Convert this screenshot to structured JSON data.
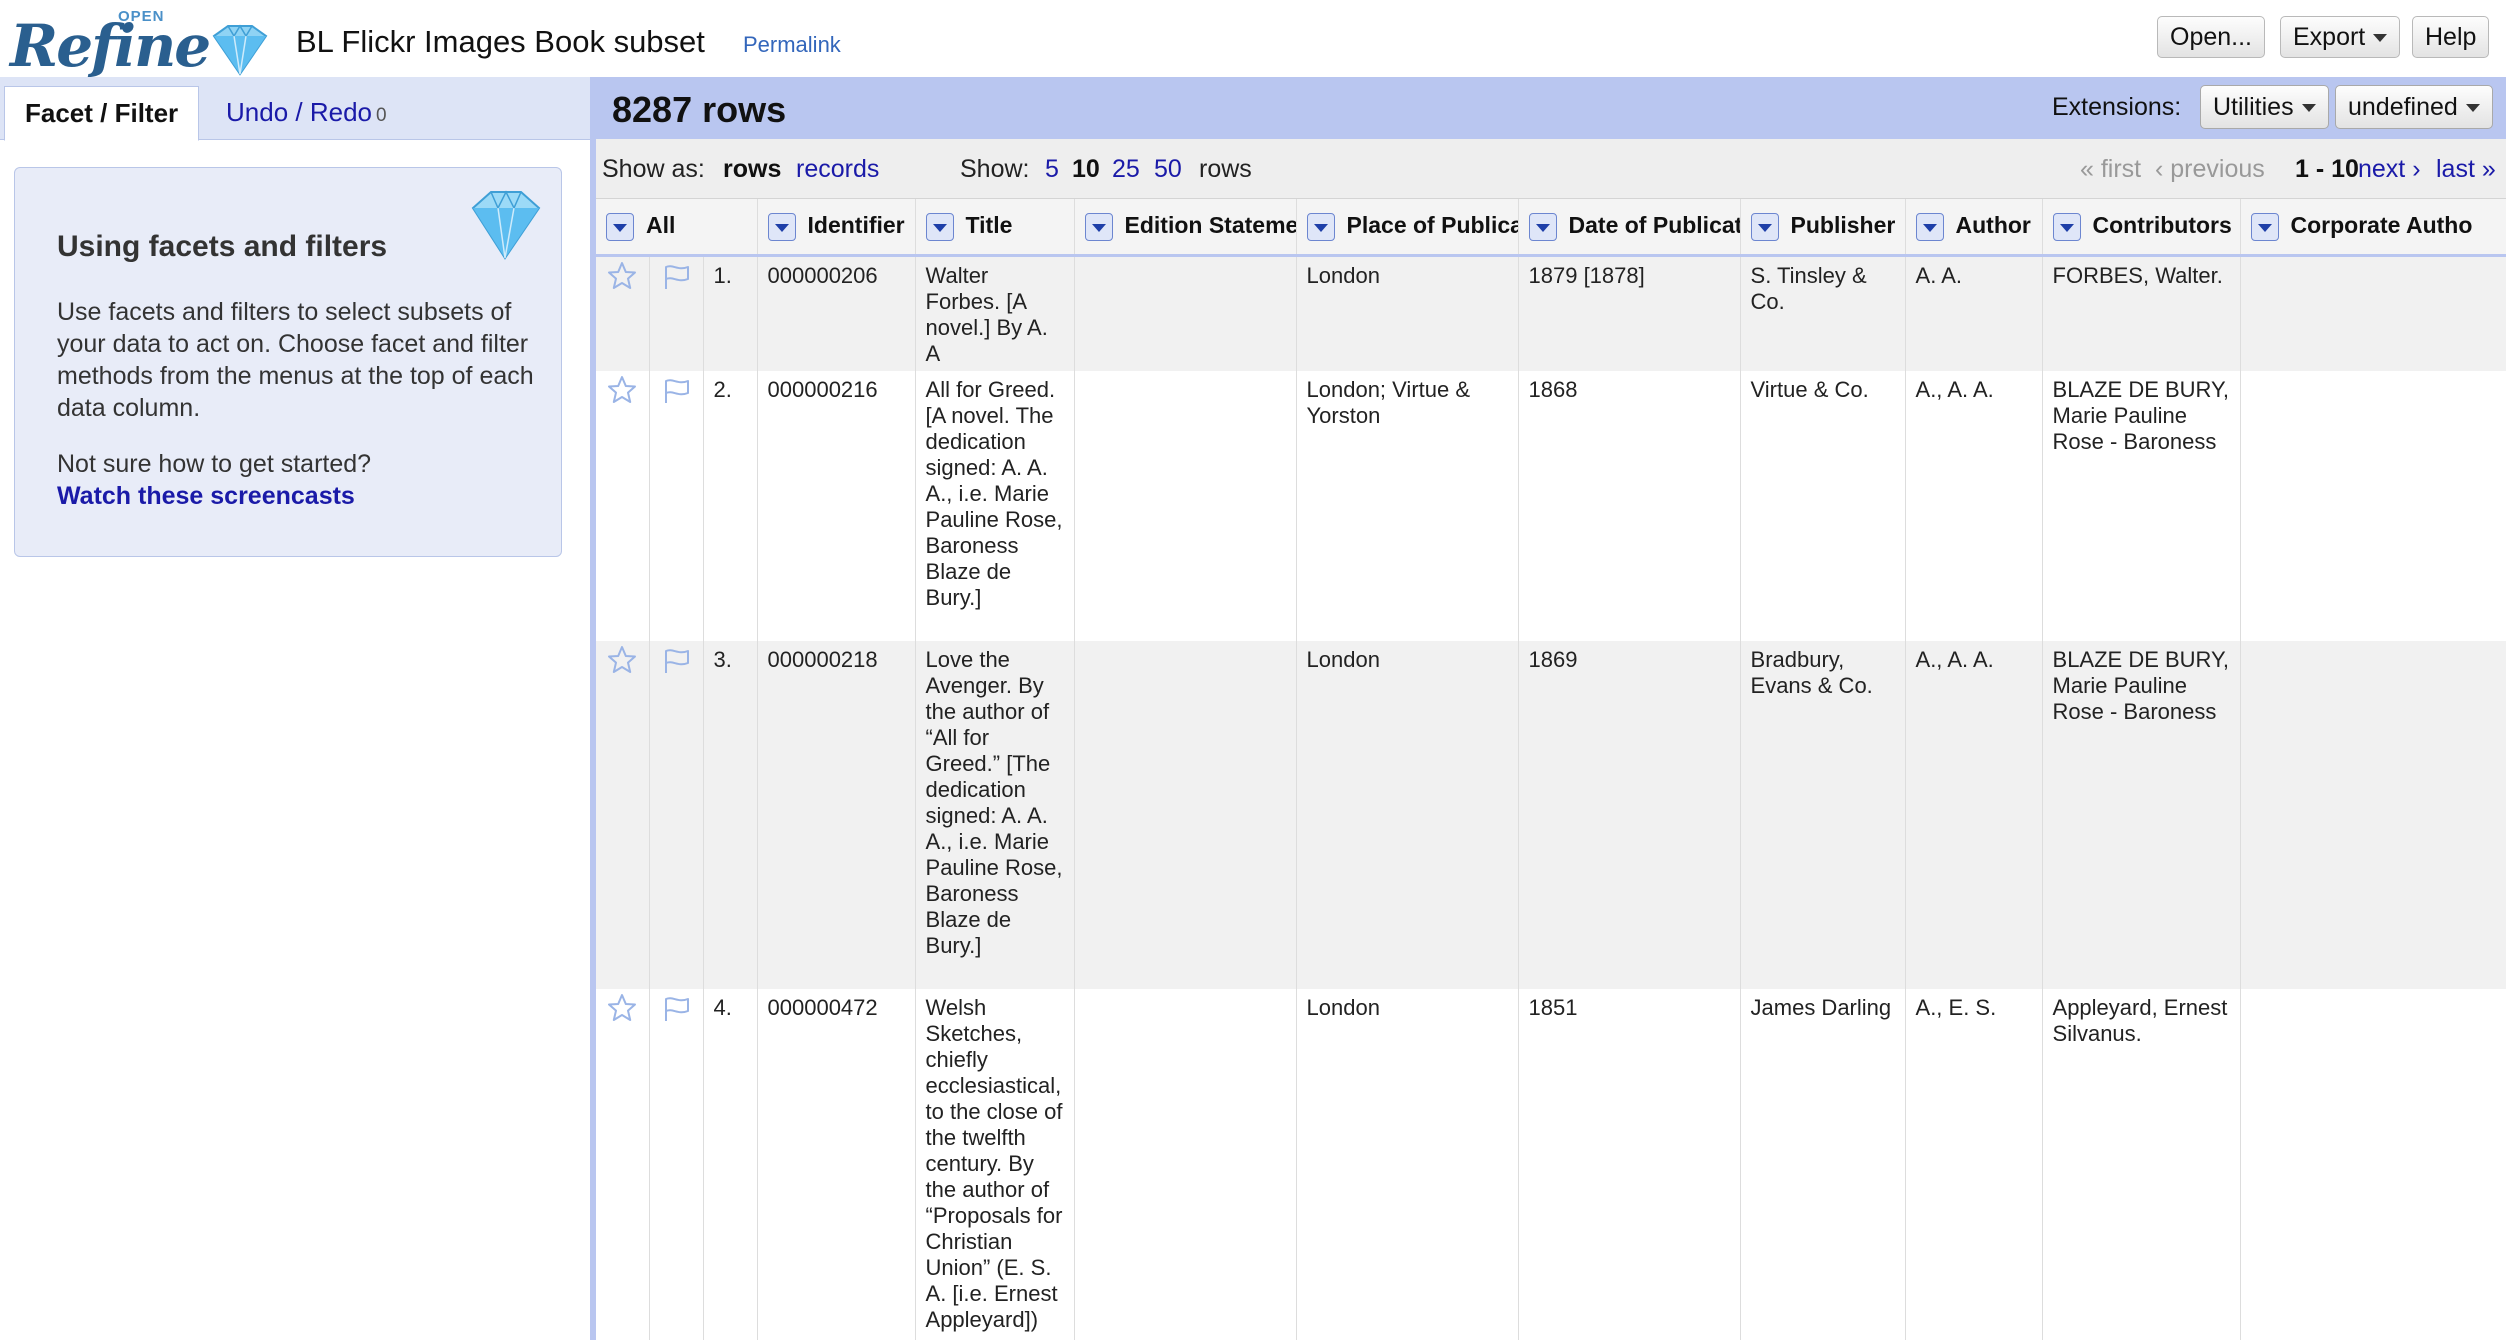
{
  "app": {
    "logo_text": "Refine",
    "logo_super": "OPEN",
    "project_title": "BL Flickr Images Book subset",
    "permalink_label": "Permalink"
  },
  "header_buttons": {
    "open": "Open...",
    "export": "Export",
    "help": "Help"
  },
  "left_panel": {
    "tabs": {
      "facet": "Facet / Filter",
      "undo": "Undo / Redo",
      "undo_count": "0"
    },
    "help": {
      "title": "Using facets and filters",
      "text": "Use facets and filters to select subsets of your data to act on. Choose facet and filter methods from the menus at the top of each data column.",
      "question": "Not sure how to get started?",
      "link": "Watch these screencasts"
    }
  },
  "summary": {
    "row_count": "8287 rows",
    "extensions_label": "Extensions:",
    "utilities": "Utilities",
    "undefined": "undefined"
  },
  "view_bar": {
    "show_as": "Show as:",
    "rows": "rows",
    "records": "records",
    "show": "Show:",
    "sizes": [
      "5",
      "10",
      "25",
      "50"
    ],
    "rows_label": "rows",
    "first": "« first",
    "previous": "‹ previous",
    "range": "1 - 10",
    "next": "next ›",
    "last": "last »"
  },
  "table": {
    "columns": [
      "All",
      "Identifier",
      "Title",
      "Edition Statemen",
      "Place of Publicat",
      "Date of Publicati",
      "Publisher",
      "Author",
      "Contributors",
      "Corporate Autho"
    ],
    "rows": [
      {
        "num": "1.",
        "identifier": "000000206",
        "title": "Walter Forbes. [A novel.] By A. A",
        "edition": "",
        "place": "London",
        "date": "1879 [1878]",
        "publisher": "S. Tinsley & Co.",
        "author": "A. A.",
        "contributors": "FORBES, Walter.",
        "corporate": ""
      },
      {
        "num": "2.",
        "identifier": "000000216",
        "title": "All for Greed. [A novel. The dedication signed: A. A. A., i.e. Marie Pauline Rose, Baroness Blaze de Bury.]",
        "edition": "",
        "place": "London; Virtue & Yorston",
        "date": "1868",
        "publisher": "Virtue & Co.",
        "author": "A., A. A.",
        "contributors": "BLAZE DE BURY, Marie Pauline Rose - Baroness",
        "corporate": ""
      },
      {
        "num": "3.",
        "identifier": "000000218",
        "title": "Love the Avenger. By the author of “All for Greed.” [The dedication signed: A. A. A., i.e. Marie Pauline Rose, Baroness Blaze de Bury.]",
        "edition": "",
        "place": "London",
        "date": "1869",
        "publisher": "Bradbury, Evans & Co.",
        "author": "A., A. A.",
        "contributors": "BLAZE DE BURY, Marie Pauline Rose - Baroness",
        "corporate": ""
      },
      {
        "num": "4.",
        "identifier": "000000472",
        "title": "Welsh Sketches, chiefly ecclesiastical, to the close of the twelfth century. By the author of “Proposals for Christian Union” (E. S. A. [i.e. Ernest Appleyard])",
        "edition": "",
        "place": "London",
        "date": "1851",
        "publisher": "James Darling",
        "author": "A., E. S.",
        "contributors": "Appleyard, Ernest Silvanus.",
        "corporate": ""
      }
    ]
  },
  "icons": {
    "star": "star-icon",
    "flag": "flag-icon",
    "diamond": "diamond-logo-icon",
    "column_menu": "dropdown-arrow-icon"
  },
  "colors": {
    "accent_blue": "#b9c6f0",
    "link": "#1a1aa8",
    "tab_bg": "#dde4f6"
  }
}
